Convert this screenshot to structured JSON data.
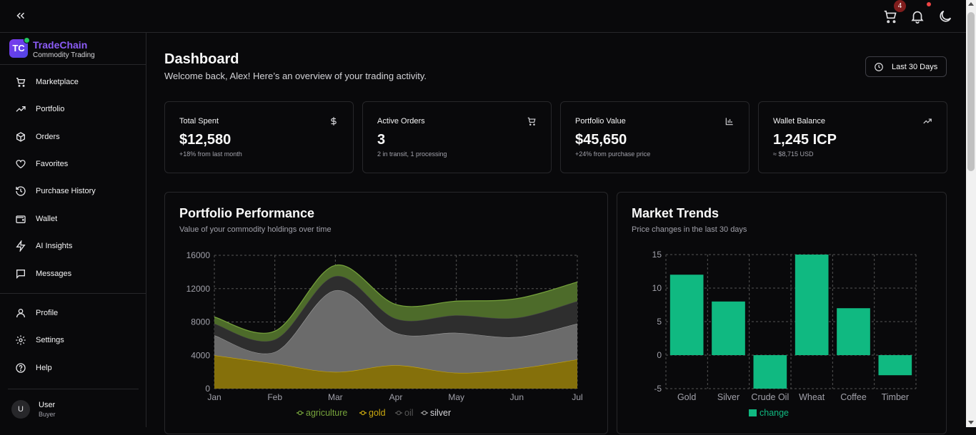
{
  "header": {
    "cart_badge": "4",
    "icons": [
      "collapse-icon",
      "cart-icon",
      "bell-icon",
      "moon-icon"
    ]
  },
  "brand": {
    "logo_text": "TC",
    "name": "TradeChain",
    "subtitle": "Commodity Trading"
  },
  "sidebar": {
    "items": [
      {
        "label": "Marketplace",
        "icon": "cart-icon"
      },
      {
        "label": "Portfolio",
        "icon": "trending-up-icon"
      },
      {
        "label": "Orders",
        "icon": "package-icon"
      },
      {
        "label": "Favorites",
        "icon": "heart-icon"
      },
      {
        "label": "Purchase History",
        "icon": "history-icon"
      },
      {
        "label": "Wallet",
        "icon": "wallet-icon"
      },
      {
        "label": "AI Insights",
        "icon": "zap-icon"
      },
      {
        "label": "Messages",
        "icon": "message-icon"
      }
    ],
    "bottom_items": [
      {
        "label": "Profile",
        "icon": "user-icon"
      },
      {
        "label": "Settings",
        "icon": "gear-icon"
      },
      {
        "label": "Help",
        "icon": "help-icon"
      }
    ],
    "user": {
      "initial": "U",
      "name": "User",
      "role": "Buyer"
    }
  },
  "page": {
    "title": "Dashboard",
    "subtitle": "Welcome back, Alex! Here’s an overview of your trading activity.",
    "range_label": "Last 30 Days"
  },
  "cards": [
    {
      "title": "Total Spent",
      "value": "$12,580",
      "note": "+18% from last month",
      "icon": "dollar-icon"
    },
    {
      "title": "Active Orders",
      "value": "3",
      "note": "2 in transit, 1 processing",
      "icon": "cart-icon"
    },
    {
      "title": "Portfolio Value",
      "value": "$45,650",
      "note": "+24% from purchase price",
      "icon": "bar-chart-icon"
    },
    {
      "title": "Wallet Balance",
      "value": "1,245 ICP",
      "note": "≈ $8,715 USD",
      "icon": "trending-up-icon"
    }
  ],
  "colors": {
    "agriculture": "#4d6b2a",
    "gold": "#85700b",
    "oil": "#2e2e2e",
    "silver": "#6b6b6b",
    "change": "#10b981"
  },
  "chart_data": [
    {
      "type": "area",
      "title": "Portfolio Performance",
      "subtitle": "Value of your commodity holdings over time",
      "stacked": true,
      "x": [
        "Jan",
        "Feb",
        "Mar",
        "Apr",
        "May",
        "Jun",
        "Jul"
      ],
      "ylim": [
        0,
        16000
      ],
      "yticks": [
        0,
        4000,
        8000,
        12000,
        16000
      ],
      "grid": true,
      "legend": "bottom",
      "series": [
        {
          "name": "gold",
          "values": [
            4000,
            3000,
            2000,
            2800,
            1900,
            2400,
            3500
          ]
        },
        {
          "name": "silver",
          "values": [
            2400,
            1400,
            9800,
            3900,
            4800,
            3800,
            4300
          ]
        },
        {
          "name": "oil",
          "values": [
            1400,
            1500,
            1700,
            1700,
            2100,
            2300,
            2700
          ]
        },
        {
          "name": "agriculture",
          "values": [
            800,
            1000,
            1300,
            1700,
            1700,
            2300,
            2300
          ]
        }
      ],
      "legend_order": [
        "agriculture",
        "gold",
        "oil",
        "silver"
      ]
    },
    {
      "type": "bar",
      "title": "Market Trends",
      "subtitle": "Price changes in the last 30 days",
      "categories": [
        "Gold",
        "Silver",
        "Crude Oil",
        "Wheat",
        "Coffee",
        "Timber"
      ],
      "series": [
        {
          "name": "change",
          "values": [
            12,
            8,
            -5,
            15,
            7,
            -3
          ]
        }
      ],
      "ylim": [
        -5,
        15
      ],
      "yticks": [
        -5,
        0,
        5,
        10,
        15
      ],
      "grid": true,
      "legend": "bottom"
    }
  ]
}
